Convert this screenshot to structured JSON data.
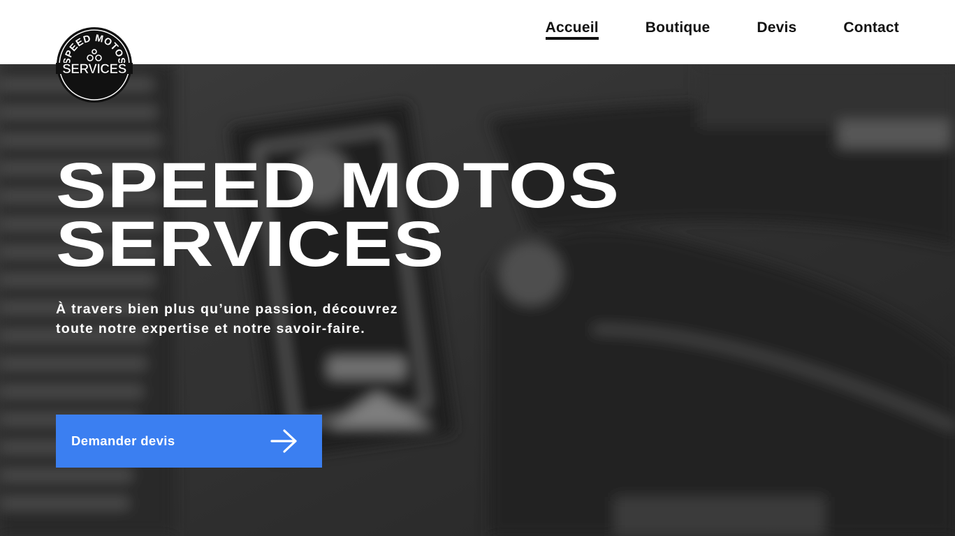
{
  "logo": {
    "top_text": "SPEED MOTOS",
    "bottom_text": "SERVICES",
    "icon": "motorcycle-badge-logo"
  },
  "nav": {
    "items": [
      {
        "label": "Accueil",
        "active": true
      },
      {
        "label": "Boutique",
        "active": false
      },
      {
        "label": "Devis",
        "active": false
      },
      {
        "label": "Contact",
        "active": false
      }
    ]
  },
  "hero": {
    "title_line1": "SPEED MOTOS",
    "title_line2": "SERVICES",
    "subtitle_line1": "À travers bien plus qu’une passion, découvrez",
    "subtitle_line2": "toute notre expertise et notre savoir-faire.",
    "cta_label": "Demander devis",
    "cta_icon": "arrow-right-icon"
  },
  "colors": {
    "accent": "#3b7ff1",
    "text_dark": "#111111",
    "hero_text": "#ffffff",
    "header_bg": "#ffffff"
  }
}
